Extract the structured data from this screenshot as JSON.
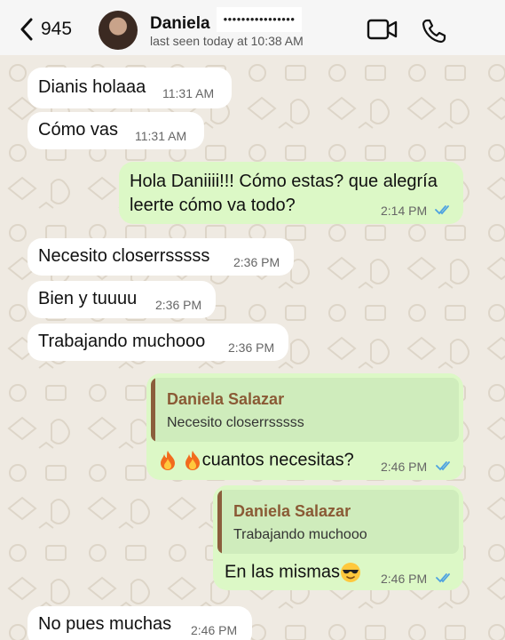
{
  "header": {
    "back_count": "945",
    "contact_name": "Daniela",
    "contact_redacted": "••••••••••••••••",
    "last_seen": "last seen today at 10:38 AM",
    "icons": [
      "chevron-left-icon",
      "video-call-icon",
      "phone-icon"
    ]
  },
  "colors": {
    "incoming_bubble": "#ffffff",
    "outgoing_bubble": "#dcf8c6",
    "read_ticks": "#4fa3e0",
    "reply_author": "#8a5a35",
    "reply_bar": "#8b5e3c"
  },
  "messages": [
    {
      "direction": "in",
      "text": "Dianis holaaa",
      "time": "11:31 AM"
    },
    {
      "direction": "in",
      "text": "Cómo vas",
      "time": "11:31 AM"
    },
    {
      "direction": "out",
      "text_line1": "Hola Daniiii!!! Cómo estas? que alegría",
      "text_line2": "leerte cómo va todo?",
      "time": "2:14 PM",
      "status": "read"
    },
    {
      "direction": "in",
      "text": "Necesito closerrsssss",
      "time": "2:36 PM"
    },
    {
      "direction": "in",
      "text": "Bien y tuuuu",
      "time": "2:36 PM"
    },
    {
      "direction": "in",
      "text": "Trabajando muchooo",
      "time": "2:36 PM"
    },
    {
      "direction": "out",
      "reply_author": "Daniela Salazar",
      "reply_text": "Necesito closerrsssss",
      "emoji": "fire-emoji-x2",
      "text": "cuantos necesitas?",
      "time": "2:46 PM",
      "status": "read"
    },
    {
      "direction": "out",
      "reply_author": "Daniela Salazar",
      "reply_text": "Trabajando muchooo",
      "text": "En las mismas",
      "emoji": "sunglasses-face-emoji",
      "time": "2:46 PM",
      "status": "read"
    },
    {
      "direction": "in",
      "text": "No pues muchas",
      "time": "2:46 PM"
    }
  ]
}
